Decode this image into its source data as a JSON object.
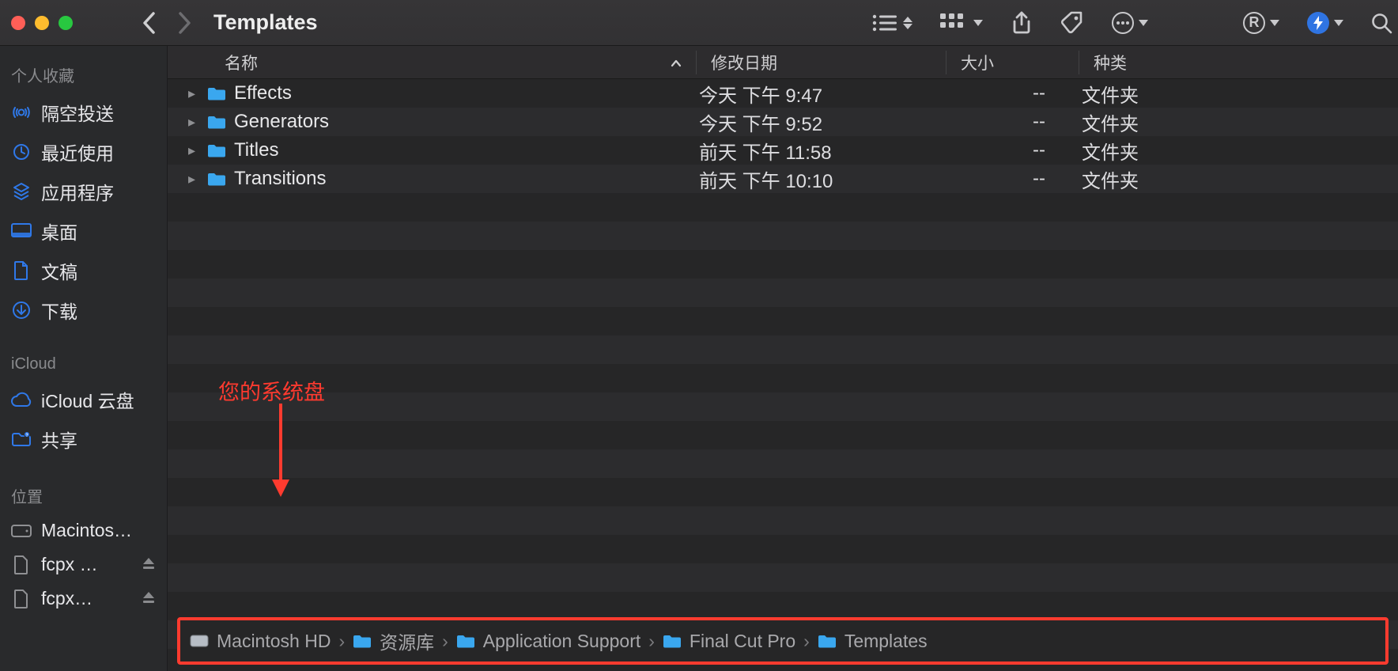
{
  "window": {
    "title": "Templates"
  },
  "sidebar": {
    "sections": [
      {
        "title": "个人收藏",
        "items": [
          {
            "icon": "airdrop",
            "label": "隔空投送"
          },
          {
            "icon": "recents",
            "label": "最近使用"
          },
          {
            "icon": "apps",
            "label": "应用程序"
          },
          {
            "icon": "desktop",
            "label": "桌面"
          },
          {
            "icon": "documents",
            "label": "文稿"
          },
          {
            "icon": "downloads",
            "label": "下载"
          }
        ]
      },
      {
        "title": "iCloud",
        "items": [
          {
            "icon": "icloud",
            "label": "iCloud 云盘"
          },
          {
            "icon": "shared",
            "label": "共享"
          }
        ]
      },
      {
        "title": "位置",
        "items": [
          {
            "icon": "disk",
            "label": "Macintos…"
          },
          {
            "icon": "doc",
            "label": "fcpx …",
            "eject": true
          },
          {
            "icon": "doc",
            "label": "fcpx…",
            "eject": true
          }
        ]
      }
    ]
  },
  "columns": {
    "name": "名称",
    "date": "修改日期",
    "size": "大小",
    "kind": "种类"
  },
  "rows": [
    {
      "name": "Effects",
      "date": "今天 下午 9:47",
      "size": "--",
      "kind": "文件夹"
    },
    {
      "name": "Generators",
      "date": "今天 下午 9:52",
      "size": "--",
      "kind": "文件夹"
    },
    {
      "name": "Titles",
      "date": "前天 下午 11:58",
      "size": "--",
      "kind": "文件夹"
    },
    {
      "name": "Transitions",
      "date": "前天 下午 10:10",
      "size": "--",
      "kind": "文件夹"
    }
  ],
  "annotation": {
    "label": "您的系统盘"
  },
  "path": [
    {
      "icon": "hdd",
      "label": "Macintosh HD"
    },
    {
      "icon": "folder",
      "label": "资源库"
    },
    {
      "icon": "folder",
      "label": "Application Support"
    },
    {
      "icon": "folder",
      "label": "Final Cut Pro"
    },
    {
      "icon": "folder",
      "label": "Templates"
    }
  ]
}
